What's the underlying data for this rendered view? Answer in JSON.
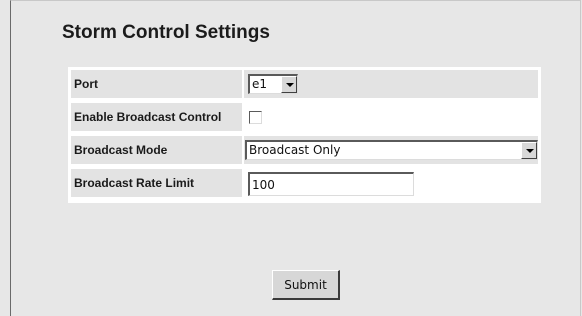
{
  "page": {
    "title": "Storm Control Settings"
  },
  "form": {
    "port": {
      "label": "Port",
      "selected": "e1"
    },
    "enable_broadcast": {
      "label": "Enable Broadcast Control",
      "checked": false
    },
    "broadcast_mode": {
      "label": "Broadcast Mode",
      "selected": "Broadcast Only"
    },
    "broadcast_rate_limit": {
      "label": "Broadcast Rate Limit",
      "value": "100"
    }
  },
  "actions": {
    "submit_label": "Submit"
  },
  "colors": {
    "background": "#e7e7e7",
    "label_cell": "#e3e3e3",
    "table_background": "#ffffff"
  },
  "icons": {
    "dropdown": "chevron-down-icon",
    "checkbox": "checkbox-unchecked"
  }
}
